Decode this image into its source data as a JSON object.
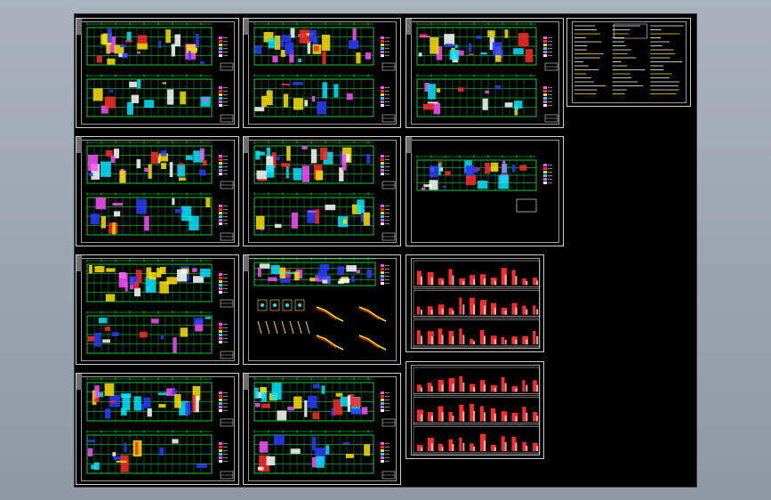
{
  "viewport": {
    "background": "#a9b2bd"
  },
  "canvas": {
    "background": "#000000"
  },
  "colors": {
    "grid_green": "#00ff3c",
    "wall_red": "#ff2a2a",
    "fill_blue": "#2a3cff",
    "accent_yellow": "#ffe000",
    "accent_magenta": "#ff4cff",
    "accent_cyan": "#00e5ff",
    "sheet_border": "#cfcfcf"
  },
  "sheets": [
    {
      "id": "plan-r1c1",
      "kind": "plans"
    },
    {
      "id": "plan-r1c2",
      "kind": "plans"
    },
    {
      "id": "plan-r1c3",
      "kind": "plans"
    },
    {
      "id": "notes-r1c4",
      "kind": "notes"
    },
    {
      "id": "plan-r2c1",
      "kind": "plans"
    },
    {
      "id": "plan-r2c2",
      "kind": "plans"
    },
    {
      "id": "plan-r2c3",
      "kind": "single"
    },
    {
      "id": "plan-r3c1",
      "kind": "plans"
    },
    {
      "id": "detail-r3c2",
      "kind": "details"
    },
    {
      "id": "section-r3c3",
      "kind": "sections"
    },
    {
      "id": "plan-r4c1",
      "kind": "plans"
    },
    {
      "id": "plan-r4c2",
      "kind": "plans"
    },
    {
      "id": "section-r4c3",
      "kind": "sections"
    }
  ]
}
